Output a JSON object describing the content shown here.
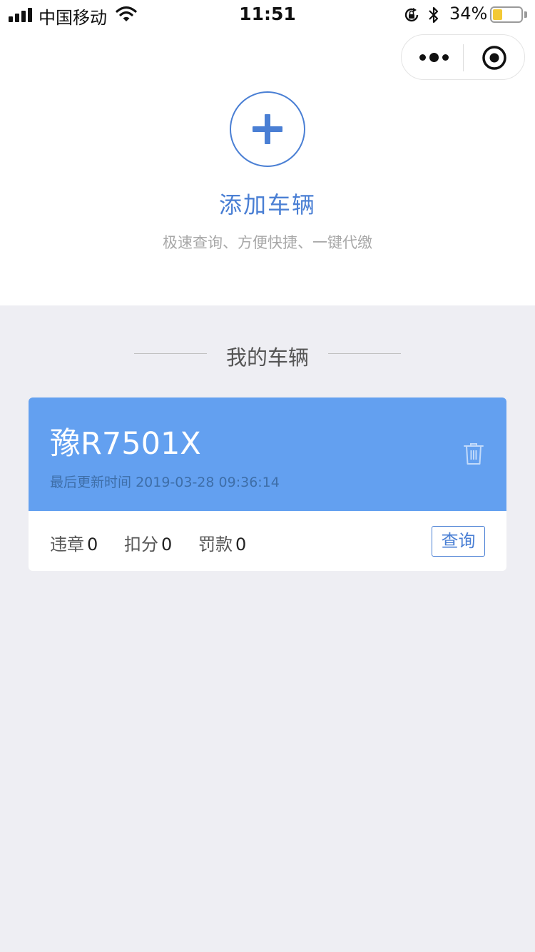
{
  "status_bar": {
    "carrier": "中国移动",
    "time": "11:51",
    "battery_percent": "34%",
    "battery_level": 0.34,
    "icons": [
      "signal-icon",
      "wifi-icon",
      "rotation-lock-icon",
      "bluetooth-icon",
      "battery-icon"
    ]
  },
  "capsule": {
    "icons": [
      "more-dots-icon",
      "close-target-icon"
    ]
  },
  "add_vehicle": {
    "icon": "plus-icon",
    "title": "添加车辆",
    "subtitle": "极速查询、方便快捷、一键代缴"
  },
  "my_vehicles": {
    "title": "我的车辆",
    "cars": [
      {
        "plate": "豫R7501X",
        "update_label": "最后更新时间",
        "update_time": "2019-03-28 09:36:14",
        "violations_label": "违章",
        "violations": "0",
        "points_label": "扣分",
        "points": "0",
        "fine_label": "罚款",
        "fine": "0",
        "query_label": "查询"
      }
    ]
  },
  "colors": {
    "accent": "#4a7fd4",
    "card_header": "#63a0f0",
    "page_background": "#eeeef3",
    "battery_fill": "#f3c935"
  }
}
